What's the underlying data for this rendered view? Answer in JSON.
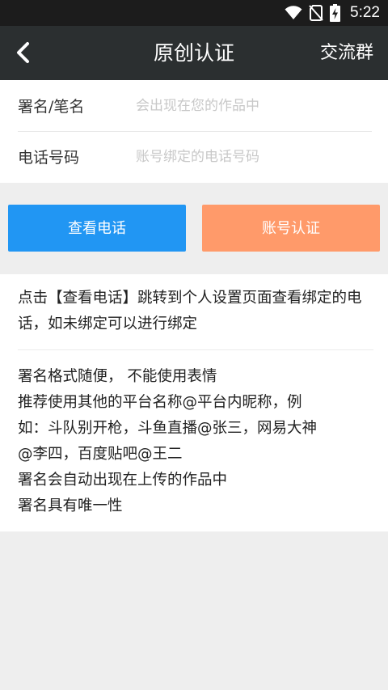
{
  "status_bar": {
    "time": "5:22",
    "icons": [
      "wifi-icon",
      "no-sim-icon",
      "battery-charging-icon"
    ]
  },
  "app_bar": {
    "title": "原创认证",
    "back_icon": "back-arrow-icon",
    "action_label": "交流群"
  },
  "form": {
    "signature_label": "署名/笔名",
    "signature_placeholder": "会出现在您的作品中",
    "signature_value": "",
    "phone_label": "电话号码",
    "phone_placeholder": "账号绑定的电话号码",
    "phone_value": ""
  },
  "buttons": {
    "view_phone": "查看电话",
    "verify_account": "账号认证"
  },
  "notes": {
    "note1": "点击【查看电话】跳转到个人设置页面查看绑定的电话，如未绑定可以进行绑定",
    "rules": [
      "署名格式随便， 不能使用表情",
      "推荐使用其他的平台名称@平台内昵称，例",
      "如：斗队别开枪，斗鱼直播@张三，网易大神",
      "@李四，百度贴吧@王二",
      "署名会自动出现在上传的作品中",
      "署名具有唯一性"
    ]
  },
  "colors": {
    "status_bar": "#1c1c1c",
    "app_bar": "#2b2f30",
    "primary_button": "#2196f3",
    "secondary_button": "#ff9a6a",
    "background": "#eeeeee"
  }
}
